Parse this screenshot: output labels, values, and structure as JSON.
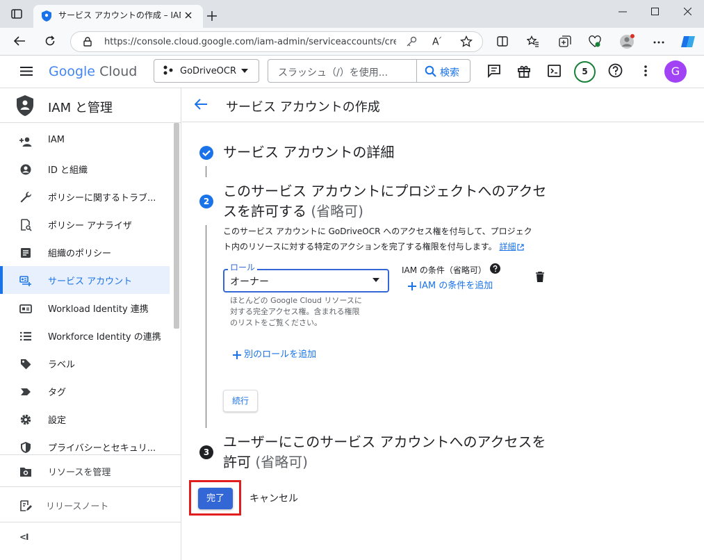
{
  "browser": {
    "tab_title": "サービス アカウントの作成 – IAM と管",
    "url": "https://console.cloud.google.com/iam-admin/serviceaccounts/cre..."
  },
  "header": {
    "logo_google": "Google",
    "logo_cloud": "Cloud",
    "project": "GoDriveOCR",
    "search_placeholder": "スラッシュ（/）を使用...",
    "search_button": "検索",
    "notification_count": "5",
    "avatar_letter": "G"
  },
  "sidebar": {
    "title": "IAM と管理",
    "items": [
      {
        "label": "IAM",
        "icon": "person-add-icon"
      },
      {
        "label": "ID と組織",
        "icon": "account-circle-icon"
      },
      {
        "label": "ポリシーに関するトラブ...",
        "icon": "wrench-icon"
      },
      {
        "label": "ポリシー アナライザ",
        "icon": "policy-analyzer-icon"
      },
      {
        "label": "組織のポリシー",
        "icon": "document-icon"
      },
      {
        "label": "サービス アカウント",
        "icon": "service-account-icon"
      },
      {
        "label": "Workload Identity 連携",
        "icon": "id-card-icon"
      },
      {
        "label": "Workforce Identity の連携",
        "icon": "list-icon"
      },
      {
        "label": "ラベル",
        "icon": "label-icon"
      },
      {
        "label": "タグ",
        "icon": "tag-icon"
      },
      {
        "label": "設定",
        "icon": "gear-icon"
      },
      {
        "label": "プライバシーとセキュリ...",
        "icon": "shield-icon"
      }
    ],
    "manage_resources": "リソースを管理",
    "release_notes": "リリースノート",
    "collapse": "<I"
  },
  "page": {
    "title": "サービス アカウントの作成",
    "step1": {
      "title": "サービス アカウントの詳細"
    },
    "step2": {
      "number": "2",
      "title_line1": "このサービス アカウントにプロジェクトへのアクセ",
      "title_line2": "スを許可する",
      "optional": "(省略可)",
      "desc_line1": "このサービス アカウントに GoDriveOCR へのアクセス権を付与して、プロジェク",
      "desc_line2": "ト内のリソースに対する特定のアクションを完了する権限を付与します。",
      "detail_link": "詳細",
      "role_label": "ロール",
      "role_value": "オーナー",
      "role_help_line1": "ほとんどの Google Cloud リソースに",
      "role_help_line2": "対する完全アクセス権。含まれる権限",
      "role_help_line3": "のリストをご覧ください。",
      "iam_condition_label": "IAM の条件（省略可）",
      "add_iam_condition": "IAM の条件を追加",
      "add_role": "別のロールを追加",
      "continue": "続行"
    },
    "step3": {
      "number": "3",
      "title_line1": "ユーザーにこのサービス アカウントへのアクセスを",
      "title_line2": "許可",
      "optional": "(省略可)"
    },
    "done": "完了",
    "cancel": "キャンセル"
  },
  "colors": {
    "accent": "#1a73e8",
    "done_button": "#3367d6",
    "highlight_box": "#e11d1d",
    "step_done": "#1a73e8",
    "step_number_bg": "#1a73e8",
    "step3_number_bg": "#202124"
  }
}
